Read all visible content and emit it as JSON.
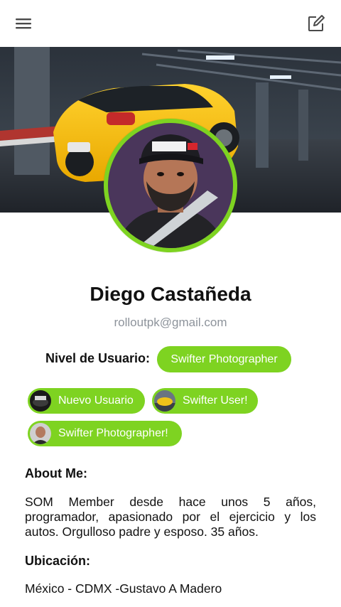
{
  "header": {
    "menu_icon": "hamburger-menu-icon",
    "edit_icon": "edit-square-icon"
  },
  "profile": {
    "name": "Diego Castañeda",
    "email": "rolloutpk@gmail.com",
    "level_label": "Nivel de Usuario:",
    "level_value": "Swifter Photographer"
  },
  "badges": [
    {
      "label": "Nuevo Usuario"
    },
    {
      "label": "Swifter User!"
    },
    {
      "label": "Swifter Photographer!"
    }
  ],
  "about": {
    "title": "About Me:",
    "text": "SOM Member desde hace unos 5 años, programador, apasionado por el ejercicio y los autos. Orgulloso padre y esposo. 35 años."
  },
  "location": {
    "title": "Ubicación:",
    "text": "México - CDMX -Gustavo A Madero"
  },
  "colors": {
    "accent": "#7ed321",
    "email_gray": "#8d939b",
    "text": "#111111"
  }
}
